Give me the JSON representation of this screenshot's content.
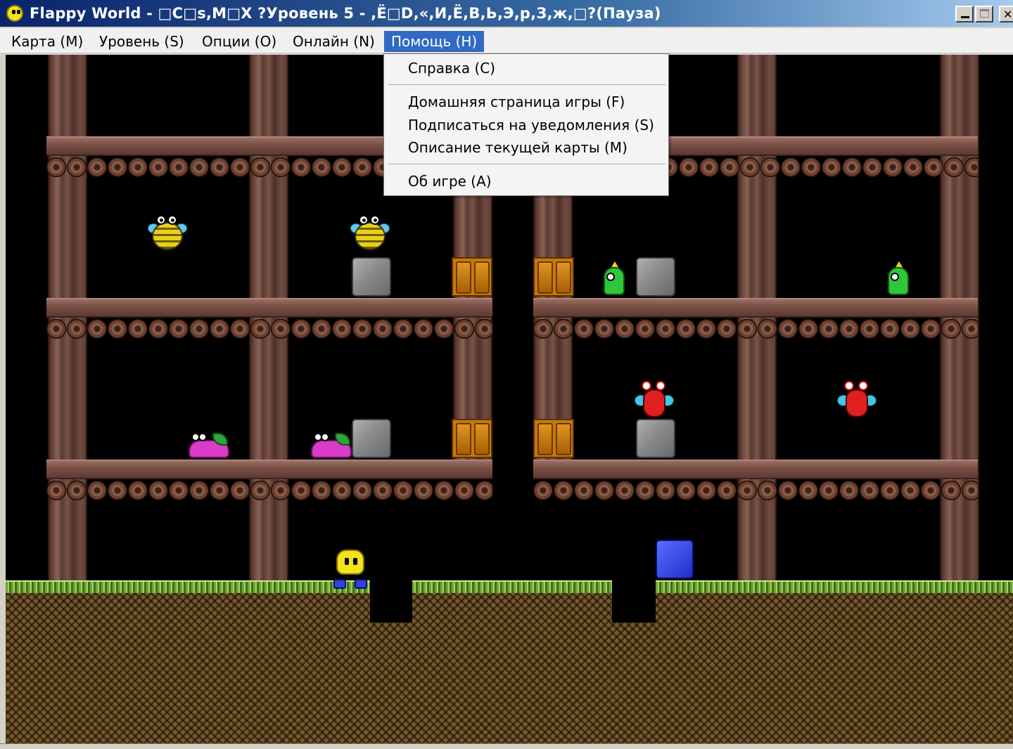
{
  "window": {
    "title": "Flappy World - □C□s,M□X ?Уровень 5 - ,Ё□D,«,И,Ё,В,Ь,Э,р,З,ж,□?(Пауза)",
    "icon": "flappy-face-icon",
    "controls": {
      "minimize_icon": "minimize-icon",
      "maximize_icon": "maximize-icon",
      "close_label": "✕"
    }
  },
  "menubar": {
    "items": [
      {
        "label": "Карта (M)"
      },
      {
        "label": "Уровень (S)"
      },
      {
        "label": "Опции (O)"
      },
      {
        "label": "Онлайн (N)"
      },
      {
        "label": "Помощь (H)",
        "open": true
      }
    ]
  },
  "help_menu": {
    "items": [
      {
        "label": "Справка (C)"
      },
      {
        "label": "Домашняя страница игры (F)"
      },
      {
        "label": "Подписаться на уведомления (S)"
      },
      {
        "label": "Описание текущей карты (M)"
      },
      {
        "label": "Об игре (A)"
      }
    ]
  },
  "game": {
    "level": "Уровень 5",
    "state": "Пауза",
    "sprites": [
      "bee",
      "bee",
      "stone",
      "door",
      "door",
      "bird",
      "stone",
      "bird",
      "slug",
      "slug",
      "stone",
      "door",
      "door",
      "bug",
      "stone",
      "bug",
      "flappy",
      "blue-block"
    ]
  },
  "colors": {
    "title_bar": "#0a246a",
    "menu_highlight": "#316ac5",
    "game_background": "#000000",
    "grass": "#6ea634",
    "earth": "#7a5a2a"
  }
}
